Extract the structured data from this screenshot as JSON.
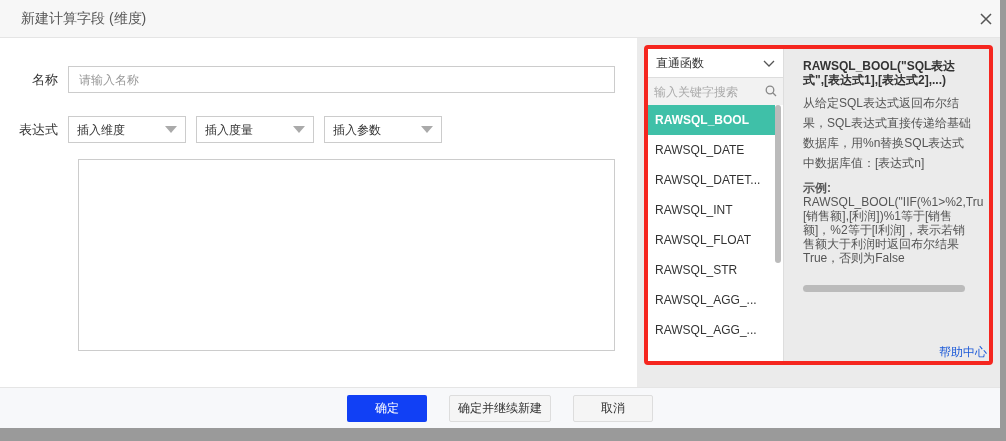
{
  "dialog": {
    "title": "新建计算字段 (维度)"
  },
  "form": {
    "name_label": "名称",
    "name_placeholder": "请输入名称",
    "expr_label": "表达式",
    "inserts": [
      "插入维度",
      "插入度量",
      "插入参数"
    ]
  },
  "functions": {
    "category": "直通函数",
    "search_placeholder": "输入关键字搜索",
    "items": [
      {
        "label": "RAWSQL_BOOL",
        "selected": true
      },
      {
        "label": "RAWSQL_DATE",
        "selected": false
      },
      {
        "label": "RAWSQL_DATET...",
        "selected": false
      },
      {
        "label": "RAWSQL_INT",
        "selected": false
      },
      {
        "label": "RAWSQL_FLOAT",
        "selected": false
      },
      {
        "label": "RAWSQL_STR",
        "selected": false
      },
      {
        "label": "RAWSQL_AGG_...",
        "selected": false
      },
      {
        "label": "RAWSQL_AGG_...",
        "selected": false
      }
    ],
    "signature": "RAWSQL_BOOL(\"SQL表达式\",[表达式1],[表达式2],...)",
    "description": "从给定SQL表达式返回布尔结果，SQL表达式直接传递给基础数据库，用%n替换SQL表达式中数据库值：[表达式n]",
    "example_label": "示例:",
    "example_lines": [
      "RAWSQL_BOOL(\"IIF(%1>%2,Tru",
      "[销售额],[利润])%1等于[销售",
      "额]，%2等于[l利润]，表示若销",
      "售额大于利润时返回布尔结果",
      "True，否则为False"
    ],
    "help_link": "帮助中心"
  },
  "buttons": [
    {
      "label": "确定",
      "kind": "primary"
    },
    {
      "label": "确定并继续新建",
      "kind": "secondary"
    },
    {
      "label": "取消",
      "kind": "secondary"
    }
  ]
}
